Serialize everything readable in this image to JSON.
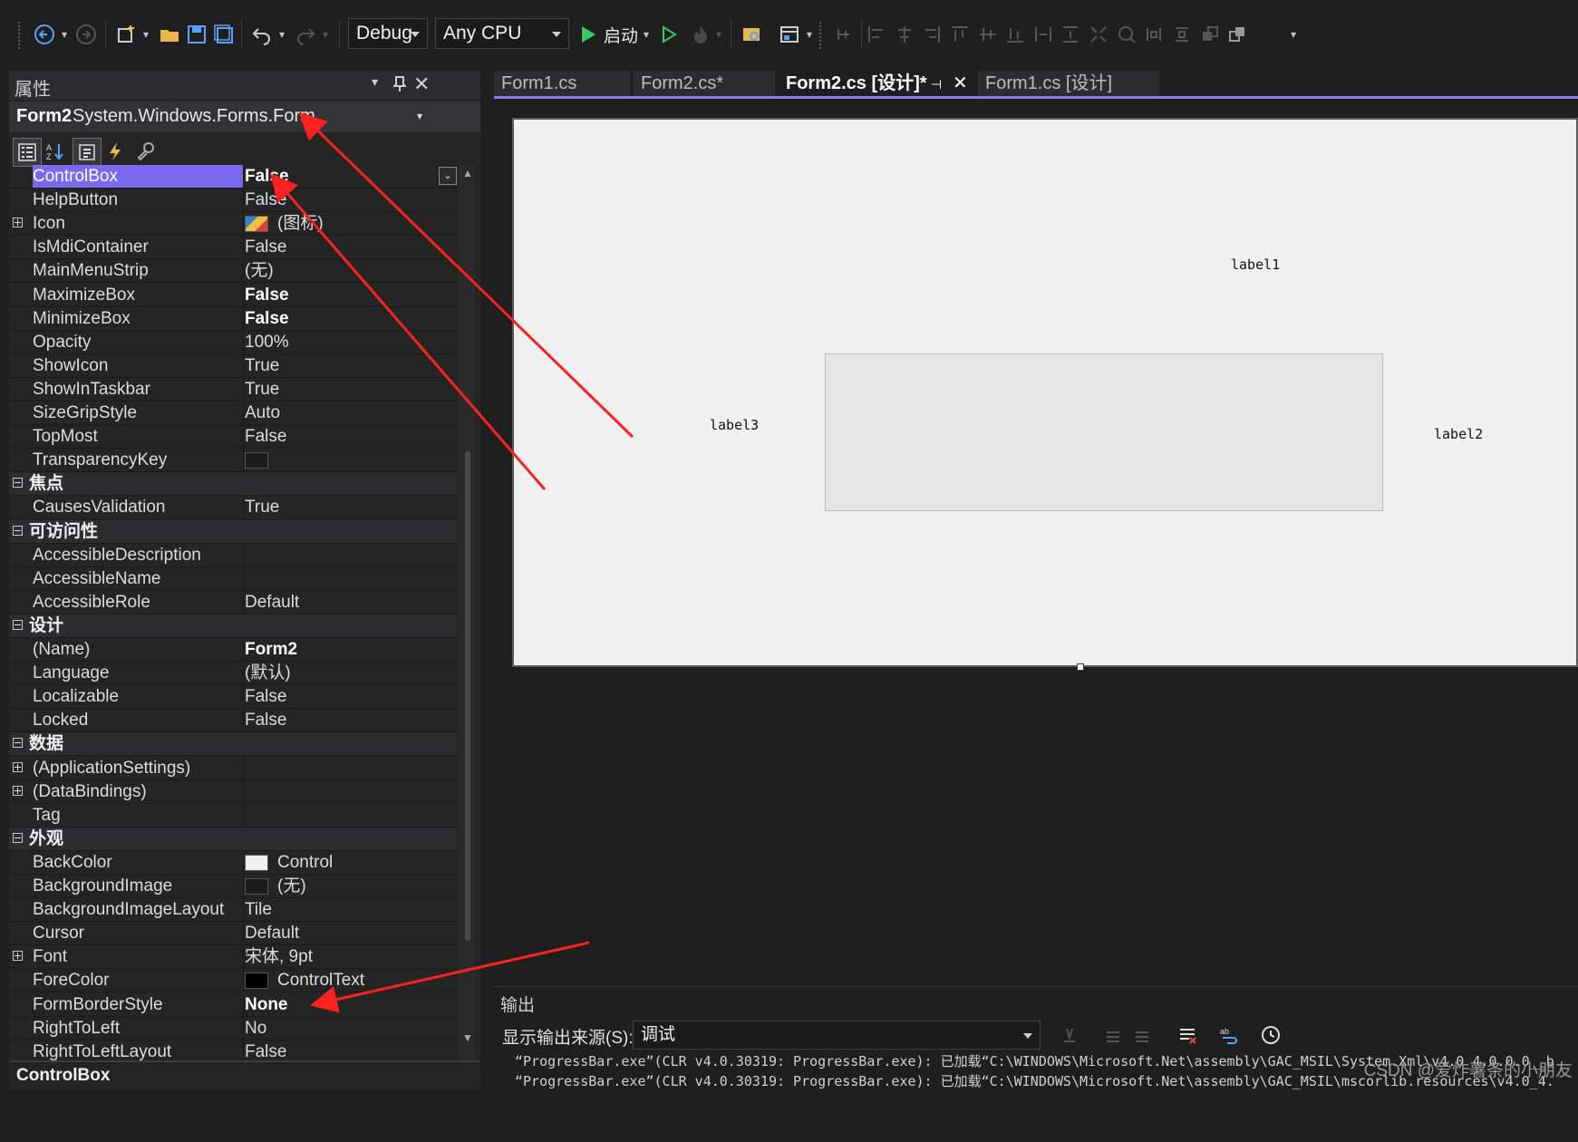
{
  "toolbar": {
    "config": "Debug",
    "platform": "Any CPU",
    "start_label": "启动"
  },
  "properties": {
    "title": "属性",
    "object_name": "Form2",
    "object_type": "System.Windows.Forms.Form",
    "rows": [
      {
        "type": "prop",
        "name": "ControlBox",
        "value": "False",
        "bold": true,
        "selected": true
      },
      {
        "type": "prop",
        "name": "HelpButton",
        "value": "False"
      },
      {
        "type": "prop",
        "name": "Icon",
        "value": "(图标)",
        "expand": true,
        "swatch": "icon"
      },
      {
        "type": "prop",
        "name": "IsMdiContainer",
        "value": "False"
      },
      {
        "type": "prop",
        "name": "MainMenuStrip",
        "value": "(无)"
      },
      {
        "type": "prop",
        "name": "MaximizeBox",
        "value": "False",
        "bold": true
      },
      {
        "type": "prop",
        "name": "MinimizeBox",
        "value": "False",
        "bold": true
      },
      {
        "type": "prop",
        "name": "Opacity",
        "value": "100%"
      },
      {
        "type": "prop",
        "name": "ShowIcon",
        "value": "True"
      },
      {
        "type": "prop",
        "name": "ShowInTaskbar",
        "value": "True"
      },
      {
        "type": "prop",
        "name": "SizeGripStyle",
        "value": "Auto"
      },
      {
        "type": "prop",
        "name": "TopMost",
        "value": "False"
      },
      {
        "type": "prop",
        "name": "TransparencyKey",
        "value": "",
        "swatch": "#1b1b1b"
      },
      {
        "type": "cat",
        "name": "焦点"
      },
      {
        "type": "prop",
        "name": "CausesValidation",
        "value": "True"
      },
      {
        "type": "cat",
        "name": "可访问性"
      },
      {
        "type": "prop",
        "name": "AccessibleDescription",
        "value": ""
      },
      {
        "type": "prop",
        "name": "AccessibleName",
        "value": ""
      },
      {
        "type": "prop",
        "name": "AccessibleRole",
        "value": "Default"
      },
      {
        "type": "cat",
        "name": "设计"
      },
      {
        "type": "prop",
        "name": "(Name)",
        "value": "Form2",
        "bold": true
      },
      {
        "type": "prop",
        "name": "Language",
        "value": "(默认)"
      },
      {
        "type": "prop",
        "name": "Localizable",
        "value": "False"
      },
      {
        "type": "prop",
        "name": "Locked",
        "value": "False"
      },
      {
        "type": "cat",
        "name": "数据"
      },
      {
        "type": "prop",
        "name": "(ApplicationSettings)",
        "value": "",
        "expand": true
      },
      {
        "type": "prop",
        "name": "(DataBindings)",
        "value": "",
        "expand": true
      },
      {
        "type": "prop",
        "name": "Tag",
        "value": ""
      },
      {
        "type": "cat",
        "name": "外观"
      },
      {
        "type": "prop",
        "name": "BackColor",
        "value": "Control",
        "swatch": "#f0f0f0"
      },
      {
        "type": "prop",
        "name": "BackgroundImage",
        "value": "(无)",
        "swatch": "#1b1b1b"
      },
      {
        "type": "prop",
        "name": "BackgroundImageLayout",
        "value": "Tile"
      },
      {
        "type": "prop",
        "name": "Cursor",
        "value": "Default"
      },
      {
        "type": "prop",
        "name": "Font",
        "value": "宋体, 9pt",
        "expand": true
      },
      {
        "type": "prop",
        "name": "ForeColor",
        "value": "ControlText",
        "swatch": "#000000"
      },
      {
        "type": "prop",
        "name": "FormBorderStyle",
        "value": "None",
        "bold": true
      },
      {
        "type": "prop",
        "name": "RightToLeft",
        "value": "No"
      },
      {
        "type": "prop",
        "name": "RightToLeftLayout",
        "value": "False"
      }
    ],
    "description_title": "ControlBox"
  },
  "tabs": [
    {
      "label": "Form1.cs"
    },
    {
      "label": "Form2.cs*"
    },
    {
      "label": "Form2.cs [设计]*"
    },
    {
      "label": "Form1.cs [设计]"
    }
  ],
  "designer": {
    "label1": "label1",
    "label2": "label2",
    "label3": "label3"
  },
  "output": {
    "title": "输出",
    "source_label": "显示输出来源(S):",
    "source_value": "调试",
    "lines": [
      "“ProgressBar.exe”(CLR v4.0.30319: ProgressBar.exe): 已加载“C:\\WINDOWS\\Microsoft.Net\\assembly\\GAC_MSIL\\System.Xml\\v4.0_4.0.0.0__b",
      "“ProgressBar.exe”(CLR v4.0.30319: ProgressBar.exe): 已加载“C:\\WINDOWS\\Microsoft.Net\\assembly\\GAC_MSIL\\mscorlib.resources\\v4.0_4."
    ]
  },
  "watermark": "CSDN @爱炸薯条的小朋友",
  "colors": {
    "accent": "#7b68ee",
    "arrow": "#ff2020"
  }
}
